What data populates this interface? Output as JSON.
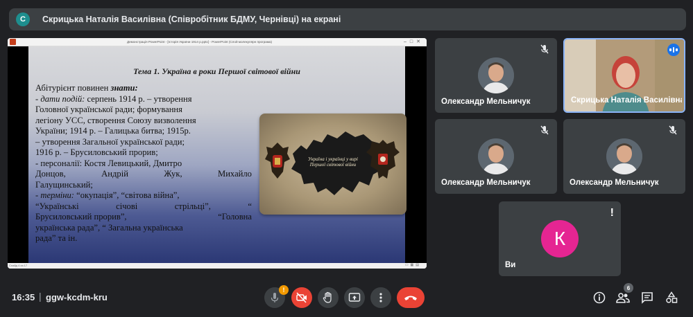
{
  "presenter_banner": {
    "avatar_letter": "С",
    "text": "Скрицька Наталія Василівна (Співробітник БДМУ, Чернівці) на екрані"
  },
  "shared_screen": {
    "app_title": "Демонстрація PowerPoint - [Історія України 1914 р.pptx] - PowerPoint (Слой молекулярн програма)",
    "status_text": "Слайд 4 из 17",
    "slide": {
      "title": "Тема 1. Україна в роки Першої світової війни",
      "must_know_prefix": "Абітурієнт повинен ",
      "must_know_bold": "знати:",
      "lines": [
        {
          "dash": "- ",
          "italic": "дати подій:",
          "text": " серпень 1914 р. – утворення"
        },
        {
          "text": "Головної української ради; формування"
        },
        {
          "text": "легіону УСС, створення Союзу визволення"
        },
        {
          "text": "України; 1914 р. – Галицька битва; 1915р."
        },
        {
          "text": "– утворення Загальної української ради;"
        },
        {
          "text": "1916 р. – Брусиловський прорив;"
        },
        {
          "text": "- персоналії: Костя Левицький, Дмитро"
        },
        {
          "words": [
            "Донцов,",
            "Андрій",
            "Жук,",
            "Михайло"
          ]
        },
        {
          "text": "Галущинський;"
        },
        {
          "dash": "- ",
          "italic": "терміни:",
          "text": " “окупація”, “світова війна”,"
        },
        {
          "words": [
            "“Українські",
            "січові",
            "стрільці”,",
            "“"
          ]
        },
        {
          "words": [
            "Брусиловський прорив”,",
            "“Головна"
          ]
        },
        {
          "text": "українська рада”, “ Загальна українська"
        },
        {
          "text": "рада” та ін."
        }
      ],
      "image_caption": "Україна і українці у вирі Першої світової війни"
    }
  },
  "participants": [
    {
      "name": "Олександр Мельничук",
      "muted": true,
      "speaking": false
    },
    {
      "name": "Скрицька Наталія Василівна",
      "muted": false,
      "speaking": true
    },
    {
      "name": "Олександр Мельничук",
      "muted": true,
      "speaking": false
    },
    {
      "name": "Олександр Мельничук",
      "muted": true,
      "speaking": false
    },
    {
      "name": "Ви",
      "avatar_letter": "К",
      "avatar_color": "#e52592",
      "alert": "!"
    }
  ],
  "bottom_bar": {
    "time": "16:35",
    "separator": "|",
    "meeting_code": "ggw-kcdm-kru",
    "mic_badge": "!",
    "people_count": "6"
  },
  "colors": {
    "background": "#202124",
    "tile": "#3c4043",
    "end_call": "#ea4335",
    "active_border": "#8ab4f8",
    "speaking": "#1a73e8"
  }
}
